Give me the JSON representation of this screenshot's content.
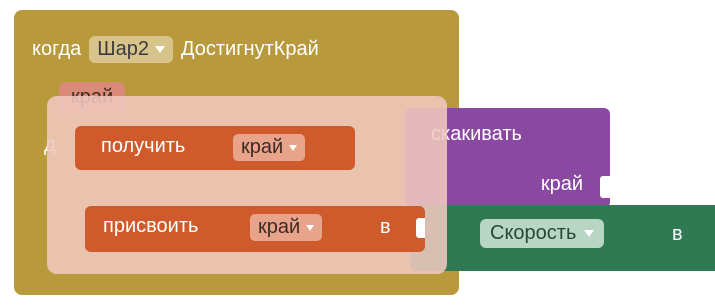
{
  "event": {
    "when_label": "когда",
    "component": "Шар2",
    "event_name": "ДостигнутКрай",
    "parameter": "край",
    "do_label": "д"
  },
  "purple_block": {
    "title": "скакивать",
    "param_label": "край"
  },
  "green_block": {
    "property": "Скорость",
    "to_label": "в"
  },
  "overlay": {
    "get_label": "получить",
    "get_variable": "край",
    "set_label": "присвоить",
    "set_variable": "край",
    "set_to_label": "в"
  },
  "colors": {
    "event_block": "#b89a3c",
    "variable_block": "#cf5a2b",
    "purple_block": "#8a49a1",
    "green_block": "#2f7a52"
  }
}
